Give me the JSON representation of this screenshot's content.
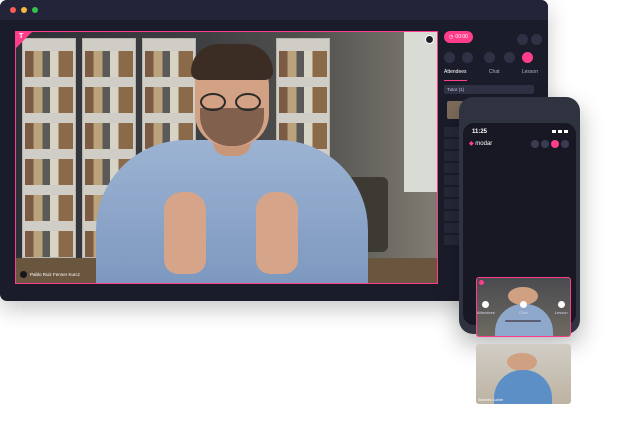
{
  "window": {
    "controls": [
      "close",
      "minimize",
      "maximize"
    ]
  },
  "stage": {
    "badge": "T",
    "name": "Pablo Ruiz Fenner Kurcz"
  },
  "rail": {
    "timer": "00:00",
    "tabs": [
      "Attendees",
      "Chat",
      "Lesson"
    ],
    "search": "Tutor (1)"
  },
  "phone": {
    "time": "11:25",
    "brand": "modar",
    "bottom_nav": [
      "Attendees",
      "Chat",
      "Lesson"
    ],
    "tiles": [
      {
        "caption": ""
      },
      {
        "caption": "Sanchez Lucine"
      }
    ]
  }
}
